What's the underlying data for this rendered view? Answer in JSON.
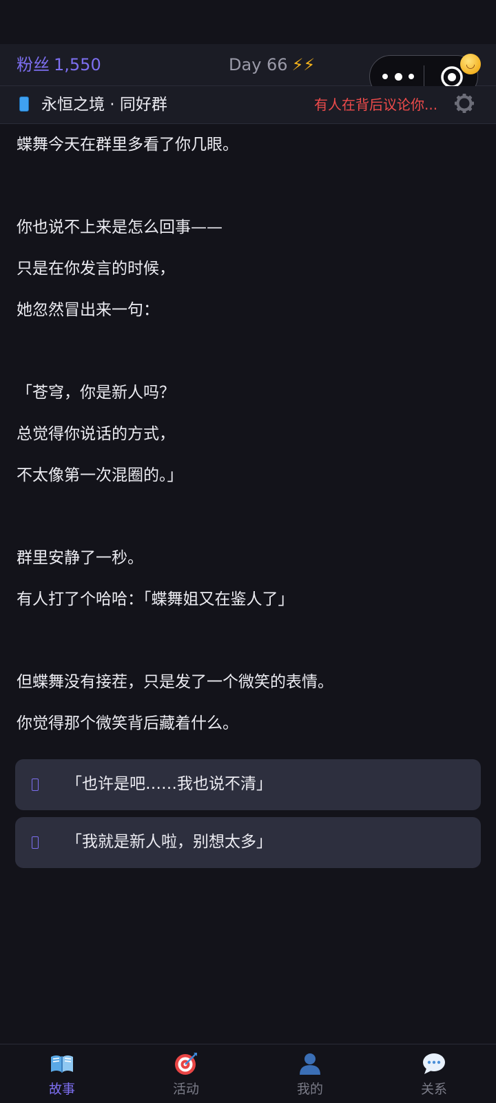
{
  "header": {
    "fans_label": "粉丝",
    "fans_count": "1,550",
    "day_label": "Day 66",
    "day_bolts": "⚡⚡"
  },
  "group_bar": {
    "name": "永恒之境 · 同好群",
    "rumor": "有人在背后议论你..."
  },
  "story": {
    "lines": [
      "蝶舞今天在群里多看了你几眼。",
      "你也说不上来是怎么回事——",
      "只是在你发言的时候，",
      "她忽然冒出来一句：",
      "「苍穹，你是新人吗？",
      "总觉得你说话的方式，",
      "不太像第一次混圈的。」",
      "群里安静了一秒。",
      "有人打了个哈哈：「蝶舞姐又在鉴人了」",
      "但蝶舞没有接茬，只是发了一个微笑的表情。",
      "你觉得那个微笑背后藏着什么。"
    ]
  },
  "choices": [
    {
      "text": "「也许是吧……我也说不清」"
    },
    {
      "text": "「我就是新人啦，别想太多」"
    }
  ],
  "tabs": [
    {
      "label": "故事",
      "icon": "book-icon",
      "active": true
    },
    {
      "label": "活动",
      "icon": "target-icon",
      "active": false
    },
    {
      "label": "我的",
      "icon": "person-icon",
      "active": false
    },
    {
      "label": "关系",
      "icon": "chat-bubble-icon",
      "active": false
    }
  ],
  "colors": {
    "accent": "#7d6ff0",
    "alert": "#ee4b4b",
    "background": "#13131a",
    "card": "#2d2f3e"
  }
}
